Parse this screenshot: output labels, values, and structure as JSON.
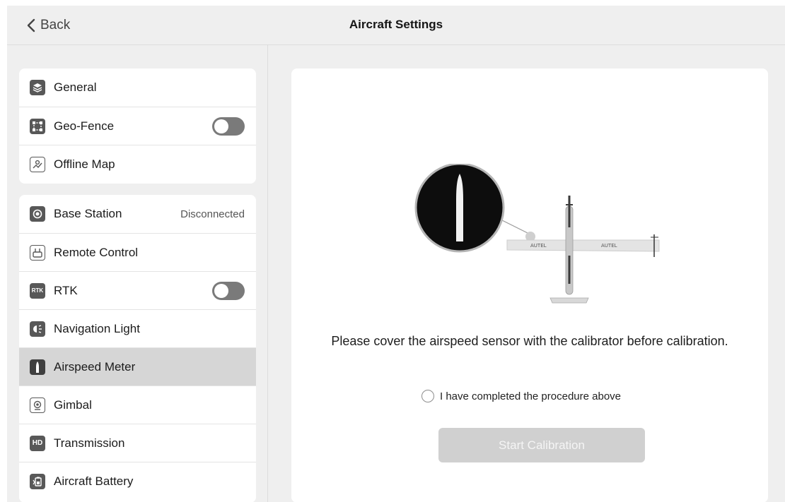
{
  "header": {
    "back_label": "Back",
    "title": "Aircraft Settings"
  },
  "sidebar": {
    "group1": [
      {
        "label": "General",
        "icon": "layers-icon"
      },
      {
        "label": "Geo-Fence",
        "icon": "geofence-icon",
        "toggle": false
      },
      {
        "label": "Offline Map",
        "icon": "map-icon"
      }
    ],
    "group2": [
      {
        "label": "Base Station",
        "icon": "base-station-icon",
        "status": "Disconnected"
      },
      {
        "label": "Remote Control",
        "icon": "remote-control-icon"
      },
      {
        "label": "RTK",
        "icon": "rtk-icon",
        "icon_text": "RTK",
        "toggle": false
      },
      {
        "label": "Navigation Light",
        "icon": "navigation-light-icon"
      },
      {
        "label": "Airspeed Meter",
        "icon": "airspeed-meter-icon",
        "selected": true
      },
      {
        "label": "Gimbal",
        "icon": "gimbal-icon"
      },
      {
        "label": "Transmission",
        "icon": "transmission-icon",
        "icon_text": "HD"
      },
      {
        "label": "Aircraft Battery",
        "icon": "battery-icon"
      }
    ]
  },
  "main": {
    "illustration": {
      "brand_left": "AUTEL",
      "brand_right": "AUTEL"
    },
    "instruction": "Please cover the airspeed sensor with the calibrator before calibration.",
    "checkbox_label": "I have completed the procedure above",
    "checkbox_checked": false,
    "start_button": "Start Calibration",
    "start_button_enabled": false
  },
  "colors": {
    "background": "#efefef",
    "card": "#ffffff",
    "selected_row": "#d6d6d6",
    "icon": "#585858",
    "toggle_off": "#7a7a7a",
    "button_disabled": "#d0d0d0"
  }
}
